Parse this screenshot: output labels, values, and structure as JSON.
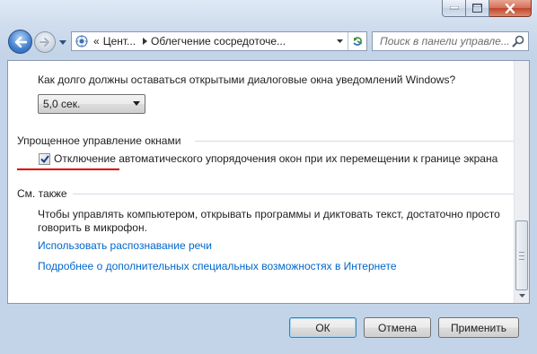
{
  "nav": {
    "breadcrumb_prefix": "«",
    "breadcrumb_1": "Цент...",
    "breadcrumb_2": "Облегчение сосредоточе...",
    "search_placeholder": "Поиск в панели управле..."
  },
  "content": {
    "dialog_question": "Как долго должны оставаться открытыми диалоговые окна уведомлений Windows?",
    "dialog_duration_value": "5,0 сек.",
    "window_section_title": "Упрощенное управление окнами",
    "snap_checkbox_label": "Отключение автоматического упорядочения окон при их перемещении к границе экрана",
    "snap_checkbox_checked": true,
    "see_also_title": "См. также",
    "speech_text_line1": "Чтобы управлять компьютером, открывать программы и диктовать текст, достаточно просто",
    "speech_text_line2": "говорить в микрофон.",
    "link_speech": "Использовать распознавание речи",
    "link_online": "Подробнее о дополнительных специальных возможностях в Интернете"
  },
  "buttons": {
    "ok_label": "ОК",
    "cancel_label": "Отмена",
    "apply_label": "Применить"
  },
  "colors": {
    "link": "#0066cc",
    "annotation_underline": "#d40000"
  }
}
